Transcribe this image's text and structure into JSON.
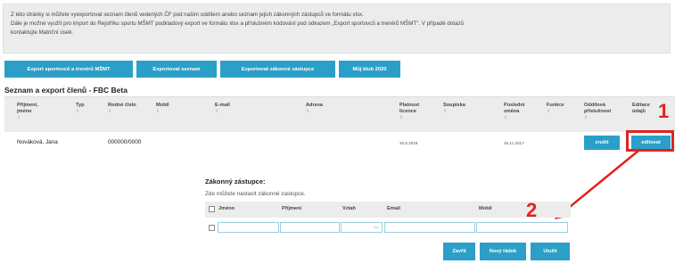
{
  "info": {
    "line1": "Z této stránky si můžete vyexportovat seznam členů vedených ČF pod naším oddílem anebo seznam jejich zákonných zástupců ve formátu xlsx.",
    "line2": "Dále je možné využít pro import do Rejstříku sportu MŠMT podkladový export ve formátu xlsx a příslušném kódování pod odkazem „Export sportovců a trenérů MŠMT\". V případě dotazů",
    "line3": "kontaktujte Matriční úsek."
  },
  "buttons": {
    "export_msmt": "Export sportovců a trenérů MŠMT",
    "export_list": "Exportovat seznam",
    "export_guardians": "Exportovat zákonné zástupce",
    "my_club": "Můj klub 2020"
  },
  "section_title": "Seznam a export členů - FBC Beta",
  "table": {
    "headers": {
      "name": "Příjmení, jméno",
      "type": "Typ",
      "birth_number": "Rodné číslo",
      "mobile": "Mobil",
      "email": "E-mail",
      "address": "Adresa",
      "license_valid": "Platnost licence",
      "roster": "Soupiska",
      "last_change": "Poslední změna",
      "function": "Funkce",
      "separate_membership": "Oddílová příslušnost",
      "edit_data": "Editace údajů"
    },
    "row": {
      "name": "Nováková, Jana",
      "birth_number": "000000/0000",
      "license_valid": "30.6.2018",
      "last_change": "25.11.2017",
      "btn_remove": "zrušit",
      "btn_edit": "editovat"
    }
  },
  "markers": {
    "one": "1",
    "two": "2"
  },
  "guardian": {
    "title": "Zákonný zástupce:",
    "subtitle": "Zde můžete nastavit zákonné zastupce.",
    "headers": {
      "first_name": "Jméno",
      "last_name": "Příjmení",
      "relation": "Vztah",
      "email": "Email",
      "mobile": "Mobil"
    },
    "btn_close": "Zavřít",
    "btn_new": "Nový řádek",
    "btn_save": "Uložit"
  },
  "colors": {
    "accent": "#2c9fc8",
    "highlight": "#e0231f"
  }
}
